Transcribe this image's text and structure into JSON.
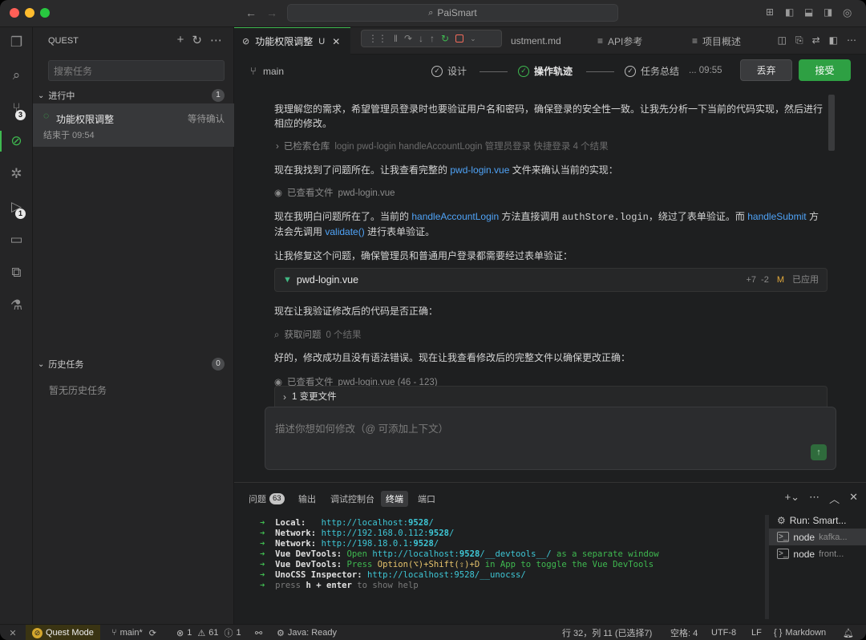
{
  "window": {
    "title": "PaiSmart"
  },
  "sidebar": {
    "header": "QUEST",
    "search_placeholder": "搜索任务",
    "in_progress": {
      "label": "进行中",
      "count": "1"
    },
    "task": {
      "title": "功能权限调整",
      "status": "等待确认",
      "ended": "结束于 09:54"
    },
    "history": {
      "label": "历史任务",
      "count": "0",
      "empty": "暂无历史任务"
    }
  },
  "activity": {
    "scm_badge": "3",
    "run_badge": "1"
  },
  "tabs": [
    {
      "label": "功能权限调整",
      "flag": "U"
    },
    {
      "label": "ustment.md"
    },
    {
      "label": "API参考"
    },
    {
      "label": "项目概述"
    }
  ],
  "steps": {
    "branch": "main",
    "s1": "设计",
    "s2": "操作轨迹",
    "s3": "任务总结",
    "time": "... 09:55",
    "discard": "丢弃",
    "accept": "接受"
  },
  "chat": {
    "p1": "我理解您的需求，希望管理员登录时也要验证用户名和密码，确保登录的安全性一致。让我先分析一下当前的代码实现，然后进行相应的修改。",
    "search_label": "已检索仓库",
    "search_detail": "login pwd-login handleAccountLogin 管理员登录 快捷登录 4 个结果",
    "p2_a": "现在我找到了问题所在。让我查看完整的",
    "p2_link": "pwd-login.vue",
    "p2_b": "文件来确认当前的实现：",
    "view1_label": "已查看文件",
    "view1_file": "pwd-login.vue",
    "p3_a": "现在我明白问题所在了。当前的",
    "p3_link1": "handleAccountLogin",
    "p3_b": "方法直接调用",
    "p3_code": "authStore.login",
    "p3_c": "，绕过了表单验证。而",
    "p3_link2": "handleSubmit",
    "p3_d": "方法会先调用",
    "p3_link3": "validate()",
    "p3_e": "进行表单验证。",
    "p4": "让我修复这个问题，确保管理员和普通用户登录都需要经过表单验证：",
    "file_card": {
      "name": "pwd-login.vue",
      "add": "+7",
      "del": "-2",
      "mod": "M",
      "state": "已应用"
    },
    "p5": "现在让我验证修改后的代码是否正确：",
    "problems_label": "获取问题",
    "problems_detail": "0 个结果",
    "p6": "好的，修改成功且没有语法错误。现在让我查看修改后的完整文件以确保更改正确：",
    "view2_label": "已查看文件",
    "view2_file": "pwd-login.vue (46 - 123)",
    "changed": "1 变更文件",
    "composer_placeholder": "描述你想如何修改（@ 可添加上下文）"
  },
  "panel": {
    "tabs": {
      "problems": "问题",
      "problems_count": "63",
      "output": "输出",
      "debug": "调试控制台",
      "terminal": "终端",
      "ports": "端口"
    },
    "terminal_list": [
      {
        "name": "Run: Smart..."
      },
      {
        "name": "node",
        "detail": "kafka..."
      },
      {
        "name": "node",
        "detail": "front..."
      }
    ]
  },
  "terminal": {
    "l1_label": "Local:",
    "l1_a": "http://localhost:",
    "l1_port": "9528",
    "l1_b": "/",
    "l2_label": "Network:",
    "l2_a": "http://192.168.0.112:",
    "l2_port": "9528",
    "l2_b": "/",
    "l3_label": "Network:",
    "l3_a": "http://198.18.0.1:",
    "l3_port": "9528",
    "l3_b": "/",
    "l4_label": "Vue DevTools:",
    "l4_a": "Open",
    "l4_url_a": "http://localhost:",
    "l4_port": "9528",
    "l4_url_b": "/__devtools__/",
    "l4_b": "as a separate window",
    "l5_label": "Vue DevTools:",
    "l5_a": "Press",
    "l5_keys": "Option(⌥)+Shift(⇧)+D",
    "l5_b": "in App to toggle the Vue DevTools",
    "l6_label": "UnoCSS Inspector:",
    "l6_url": "http://localhost:9528/__unocss/",
    "l7_a": "press",
    "l7_key": "h + enter",
    "l7_b": "to show help"
  },
  "status": {
    "mode": "Quest Mode",
    "branch": "main*",
    "errors": "1",
    "warnings": "61",
    "infos": "1",
    "java": "Java: Ready",
    "position": "行 32，列 11 (已选择7)",
    "spaces": "空格: 4",
    "encoding": "UTF-8",
    "eol": "LF",
    "language": "Markdown"
  },
  "colors": {
    "accent": "#3fb950",
    "link": "#4fa3f7",
    "accept_btn": "#2ea043"
  }
}
